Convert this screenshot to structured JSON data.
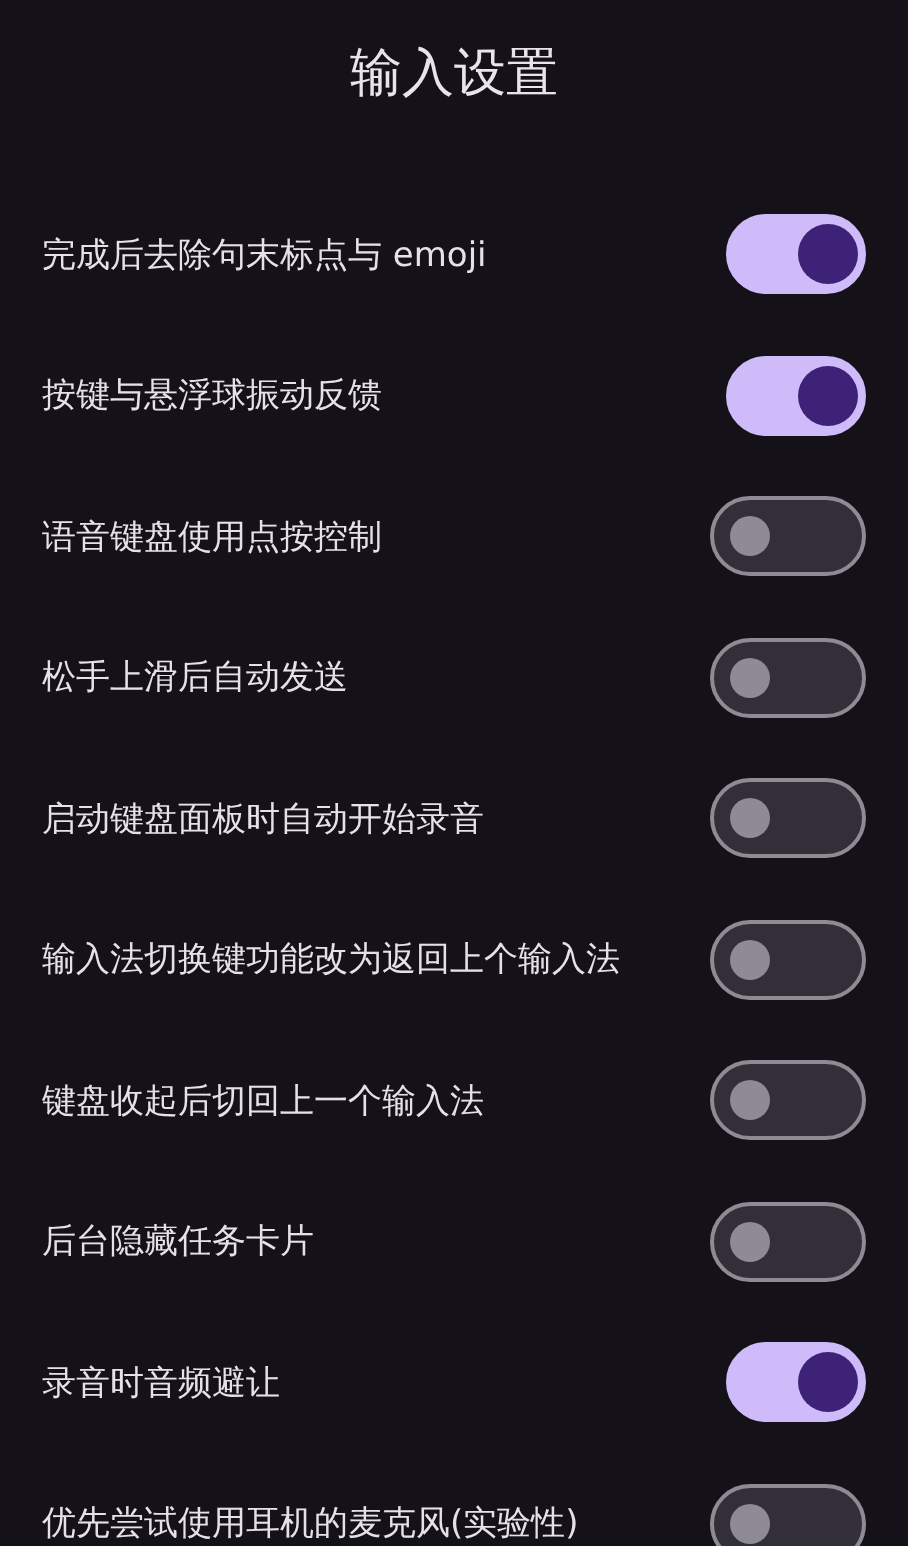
{
  "title": "输入设置",
  "settings": [
    {
      "label": "完成后去除句末标点与 emoji",
      "on": true
    },
    {
      "label": "按键与悬浮球振动反馈",
      "on": true
    },
    {
      "label": "语音键盘使用点按控制",
      "on": false
    },
    {
      "label": "松手上滑后自动发送",
      "on": false
    },
    {
      "label": "启动键盘面板时自动开始录音",
      "on": false
    },
    {
      "label": "输入法切换键功能改为返回上个输入法",
      "on": false
    },
    {
      "label": "键盘收起后切回上一个输入法",
      "on": false
    },
    {
      "label": "后台隐藏任务卡片",
      "on": false
    },
    {
      "label": "录音时音频避让",
      "on": true
    },
    {
      "label": "优先尝试使用耳机的麦克风(实验性)",
      "on": false
    }
  ]
}
